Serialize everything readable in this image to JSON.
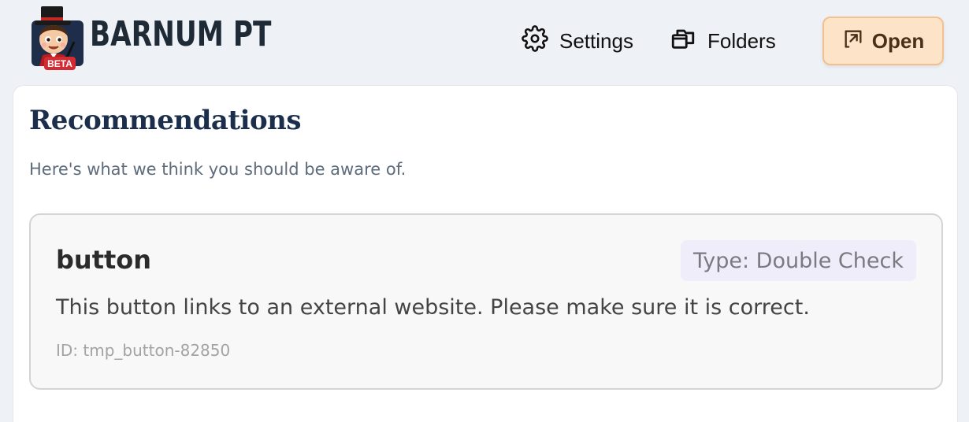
{
  "header": {
    "brand": "BARNUM PT",
    "badge": "BETA",
    "nav": {
      "settings_label": "Settings",
      "folders_label": "Folders",
      "open_label": "Open"
    }
  },
  "main": {
    "title": "Recommendations",
    "subtitle": "Here's what we think you should be aware of.",
    "recommendations": [
      {
        "title": "button",
        "type": "Type: Double Check",
        "description": "This button links to an external website. Please make sure it is correct.",
        "id": "ID: tmp_button-82850"
      }
    ]
  },
  "icons": {
    "settings": "gear-icon",
    "folders": "folders-icon",
    "open": "open-external-icon",
    "logo": "magician-mascot-logo"
  },
  "colors": {
    "page_bg": "#eef1f5",
    "title": "#1b2f4d",
    "open_button_bg": "#fde3c8",
    "open_button_border": "#f3c08f",
    "badge_bg": "#efedf9",
    "beta_red": "#d22b34"
  }
}
